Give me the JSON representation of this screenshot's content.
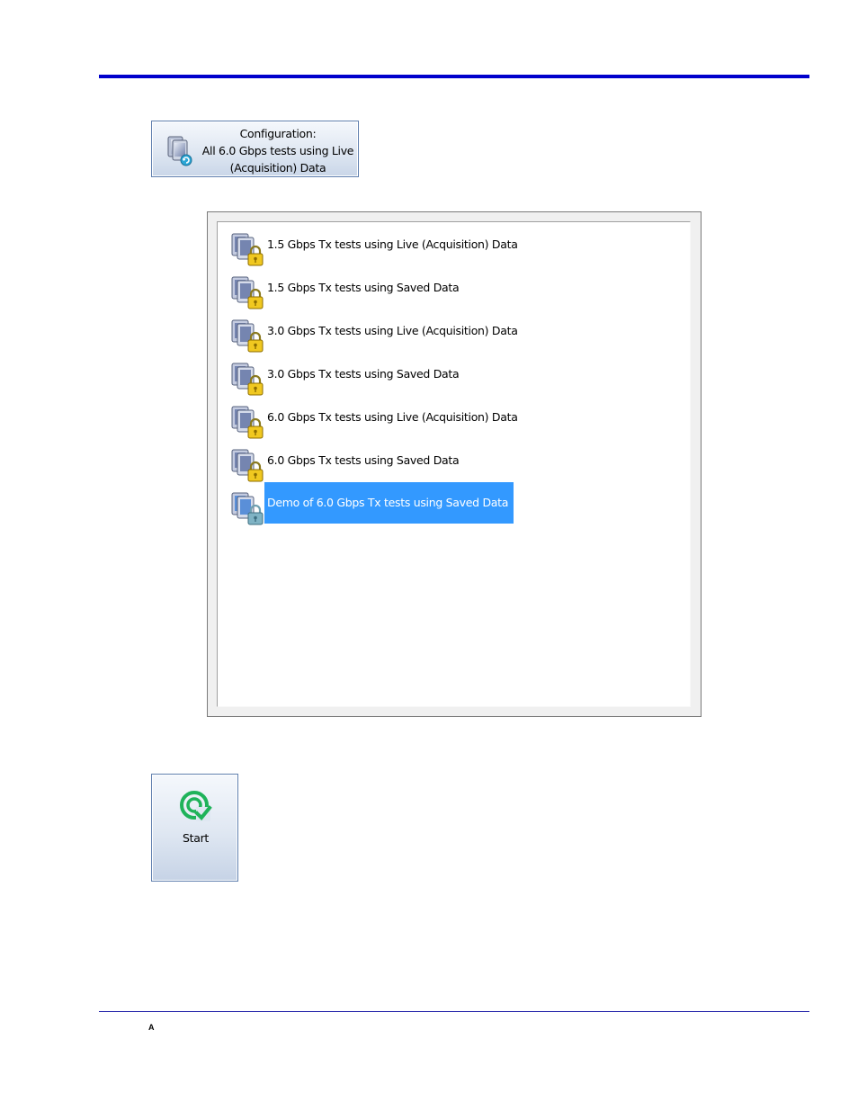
{
  "configuration_button": {
    "line1": "Configuration:",
    "line2": "All 6.0 Gbps tests using Live",
    "line3": "(Acquisition) Data",
    "icon": "configuration-icon"
  },
  "test_list": {
    "items": [
      {
        "label": "1.5 Gbps Tx tests using Live (Acquisition) Data",
        "icon": "locked-config-icon"
      },
      {
        "label": "1.5 Gbps Tx tests using Saved Data",
        "icon": "locked-config-icon"
      },
      {
        "label": "3.0 Gbps Tx tests using Live (Acquisition) Data",
        "icon": "locked-config-icon"
      },
      {
        "label": "3.0 Gbps Tx tests using Saved Data",
        "icon": "locked-config-icon"
      },
      {
        "label": "6.0 Gbps Tx tests using Live (Acquisition) Data",
        "icon": "locked-config-icon"
      },
      {
        "label": "6.0 Gbps Tx tests using Saved Data",
        "icon": "locked-config-icon"
      },
      {
        "label": "Demo of 6.0 Gbps Tx tests using  Saved Data",
        "icon": "locked-config-icon",
        "selected": true
      }
    ],
    "selection_color": "#3399ff"
  },
  "start_button": {
    "label": "Start",
    "icon": "start-icon",
    "icon_color": "#1fb35a"
  },
  "footer": {
    "mark": "A"
  },
  "colors": {
    "rule": "#0000cc",
    "button_border": "#5f7fae"
  }
}
